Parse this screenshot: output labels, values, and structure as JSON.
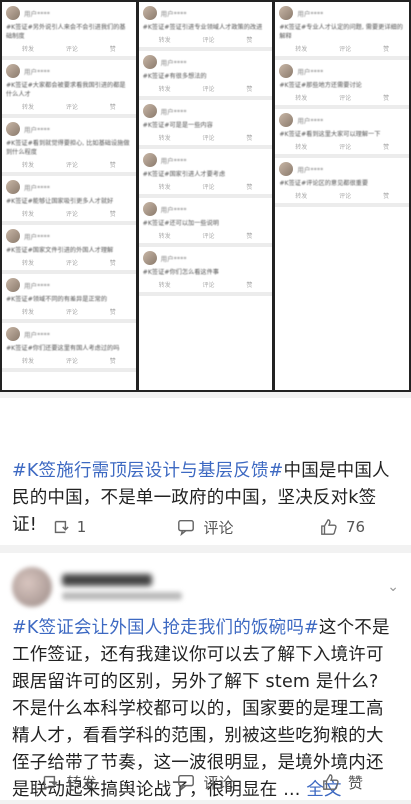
{
  "collage": {
    "col1": [
      {
        "name": "用户****",
        "text": "#K签证#另外说引人来会不会引进我们的基础制度",
        "actions": [
          "转发",
          "评论",
          "赞"
        ]
      },
      {
        "name": "用户****",
        "text": "#K签证#大家都会被要求看我国引进的都是什么人才",
        "actions": [
          "转发",
          "评论",
          "赞"
        ]
      },
      {
        "name": "用户****",
        "text": "#K签证#看到就觉得要担心, 比如基础设施做到什么程度",
        "actions": [
          "转发",
          "评论",
          "赞"
        ]
      },
      {
        "name": "用户****",
        "text": "#K签证#能够让国家吸引更多人才就好",
        "actions": [
          "转发",
          "评论",
          "赞"
        ]
      },
      {
        "name": "用户****",
        "text": "#K签证#国家文件引进的外国人才理解",
        "actions": [
          "转发",
          "评论",
          "赞"
        ]
      },
      {
        "name": "用户****",
        "text": "#K签证#领域不同的有差异是正常的",
        "actions": [
          "转发",
          "评论",
          "赞"
        ]
      },
      {
        "name": "用户****",
        "text": "#K签证#你们还要这里有国人考虑过的吗",
        "actions": [
          "转发",
          "评论",
          "赞"
        ]
      }
    ],
    "col2": [
      {
        "name": "用户****",
        "text": "#K签证#签证引进专业领域人才政策的改进",
        "actions": [
          "转发",
          "评论",
          "赞"
        ]
      },
      {
        "name": "用户****",
        "text": "#K签证#有很多想法的",
        "actions": [
          "转发",
          "评论",
          "赞"
        ]
      },
      {
        "name": "用户****",
        "text": "#K签证#可是是一些内容",
        "actions": [
          "转发",
          "评论",
          "赞"
        ]
      },
      {
        "name": "用户****",
        "text": "#K签证#国家引进人才要考虑",
        "actions": [
          "转发",
          "评论",
          "赞"
        ]
      },
      {
        "name": "用户****",
        "text": "#K签证#还可以加一些说明",
        "actions": [
          "转发",
          "评论",
          "赞"
        ]
      },
      {
        "name": "用户****",
        "text": "#K签证#你们怎么看这件事",
        "actions": [
          "转发",
          "评论",
          "赞"
        ]
      }
    ],
    "col3": [
      {
        "name": "用户****",
        "text": "#K签证#专业人才认定的问题, 需要更详细的解释",
        "actions": [
          "转发",
          "评论",
          "赞"
        ]
      },
      {
        "name": "用户****",
        "text": "#K签证#那些地方还需要讨论",
        "actions": [
          "转发",
          "评论",
          "赞"
        ]
      },
      {
        "name": "用户****",
        "text": "#K签证#看到这里大家可以理解一下",
        "actions": [
          "转发",
          "评论",
          "赞"
        ]
      },
      {
        "name": "用户****",
        "text": "#K签证#评论区的意见都很重要",
        "actions": [
          "转发",
          "评论",
          "赞"
        ]
      }
    ]
  },
  "post1": {
    "tag": "#K签施行需顶层设计与基层反馈#",
    "text": "中国是中国人民的中国，不是单一政府的中国，坚决反对k签证!",
    "repost_count": "1",
    "comment_label": "评论",
    "like_count": "76"
  },
  "post2": {
    "tag": "#K签证会让外国人抢走我们的饭碗吗#",
    "text": "这个不是工作签证，还有我建议你可以去了解下入境许可跟居留许可的区别，另外了解下 stem 是什么? 不是什么本科学校都可以的，国家要的是理工高精人才，看看学科的范围，别被这些吃狗粮的大侄子给带了节奏，这一波很明显，是境外境内还是联动起来搞舆论战了，很明显在 ... ",
    "more": "全文",
    "repost_label": "转发",
    "comment_label": "评论",
    "like_label": "赞"
  },
  "colors": {
    "link": "#3d69c2",
    "text": "#222222",
    "muted": "#555555"
  }
}
